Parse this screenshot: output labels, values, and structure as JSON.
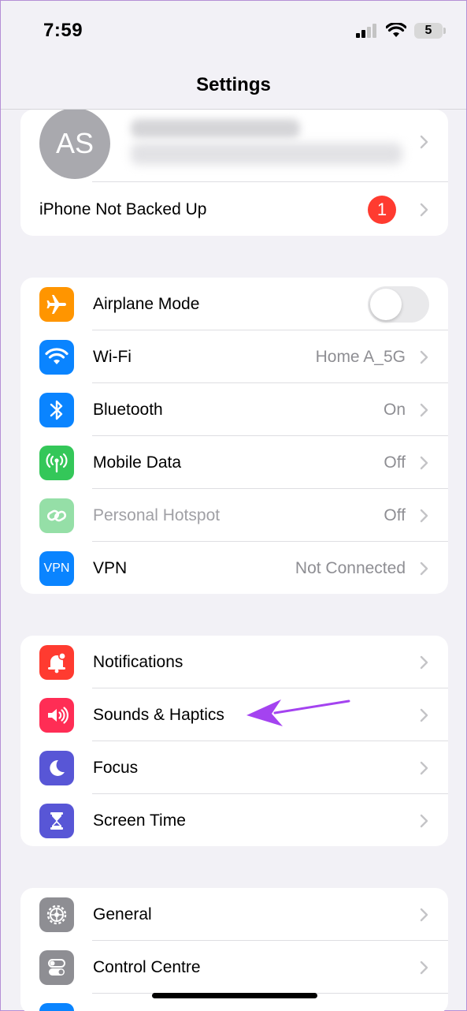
{
  "status": {
    "time": "7:59",
    "battery": "5",
    "icons": [
      "signal-icon",
      "wifi-icon",
      "battery-icon"
    ]
  },
  "nav": {
    "title": "Settings"
  },
  "profile": {
    "initials": "AS",
    "backup_label": "iPhone Not Backed Up",
    "backup_badge": "1"
  },
  "connectivity": [
    {
      "label": "Airplane Mode",
      "value": "",
      "icon": "airplane-icon",
      "color": "#ff9500",
      "toggle": true
    },
    {
      "label": "Wi-Fi",
      "value": "Home A_5G",
      "icon": "wifi-icon",
      "color": "#0a84ff"
    },
    {
      "label": "Bluetooth",
      "value": "On",
      "icon": "bluetooth-icon",
      "color": "#0a84ff"
    },
    {
      "label": "Mobile Data",
      "value": "Off",
      "icon": "antenna-icon",
      "color": "#34c759"
    },
    {
      "label": "Personal Hotspot",
      "value": "Off",
      "icon": "hotspot-icon",
      "color": "#95dfa7",
      "disabled": true
    },
    {
      "label": "VPN",
      "value": "Not Connected",
      "icon": "vpn-icon",
      "color": "#0a84ff",
      "icon_text": "VPN"
    }
  ],
  "attention": [
    {
      "label": "Notifications",
      "icon": "bell-icon",
      "color": "#ff3b30"
    },
    {
      "label": "Sounds & Haptics",
      "icon": "speaker-icon",
      "color": "#ff2d55"
    },
    {
      "label": "Focus",
      "icon": "moon-icon",
      "color": "#5856d6"
    },
    {
      "label": "Screen Time",
      "icon": "hourglass-icon",
      "color": "#5856d6"
    }
  ],
  "system": [
    {
      "label": "General",
      "icon": "gear-icon",
      "color": "#8e8e93"
    },
    {
      "label": "Control Centre",
      "icon": "switches-icon",
      "color": "#8e8e93"
    }
  ],
  "annotation": {
    "color": "#a443f0"
  }
}
